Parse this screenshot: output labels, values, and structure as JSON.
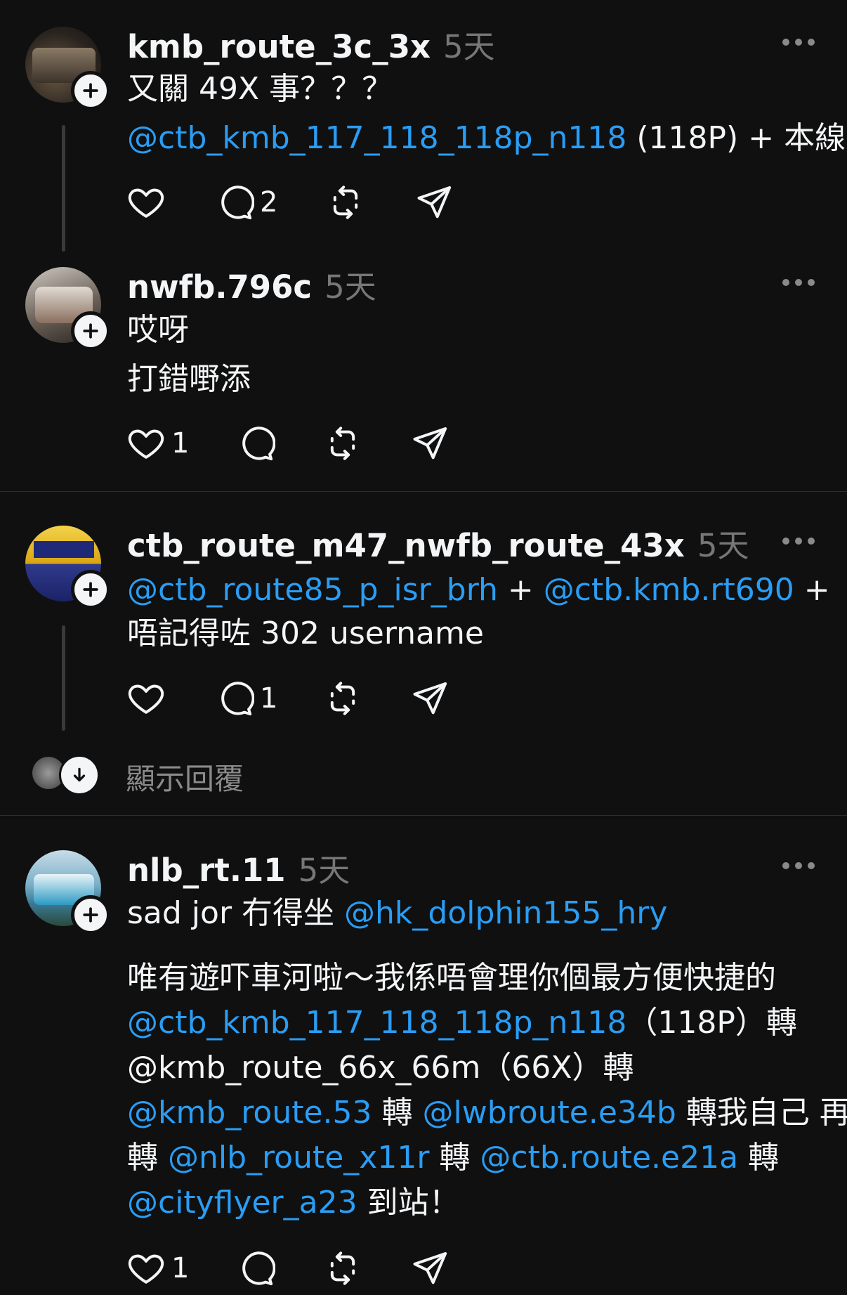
{
  "posts": [
    {
      "username": "kmb_route_3c_3x",
      "time": "5天",
      "line1": "又關 49X 事？？？",
      "line2_mention": "@ctb_kmb_117_118_118p_n118",
      "line2_rest": " (118P) + 本線",
      "likes": "",
      "replies": "2"
    },
    {
      "username": "nwfb.796c",
      "time": "5天",
      "line1": "哎呀",
      "line2": "打錯嘢添",
      "likes": "1",
      "replies": ""
    },
    {
      "username": "ctb_route_m47_nwfb_route_43x",
      "time": "5天",
      "l1_m1": "@ctb_route85_p_isr_brh",
      "l1_t1": " + ",
      "l1_m2": "@ctb.kmb.rt690",
      "l1_t2": " +",
      "line2": "唔記得咗 302 username",
      "likes": "",
      "replies": "1"
    },
    {
      "username": "nlb_rt.11",
      "time": "5天",
      "l1_t1": "sad jor 冇得坐 ",
      "l1_m1": "@hk_dolphin155_hry",
      "l2": "唯有遊吓車河啦～我係唔會理你個最方便快捷的",
      "l3_m1": "@ctb_kmb_117_118_118p_n118",
      "l3_t1": "（118P）轉",
      "l4": "@kmb_route_66x_66m（66X）轉",
      "l5_m1": "@kmb_route.53",
      "l5_t1": " 轉 ",
      "l5_m2": "@lwbroute.e34b",
      "l5_t2": " 轉我自己 再",
      "l6_t1": "轉 ",
      "l6_m1": "@nlb_route_x11r",
      "l6_t2": "  轉 ",
      "l6_m2": "@ctb.route.e21a",
      "l6_t3": "  轉",
      "l7_m1": "@cityflyer_a23",
      "l7_t1": "  到站！",
      "likes": "1",
      "replies": ""
    }
  ],
  "show_replies": "顯示回覆",
  "icons": [
    "heart-icon",
    "comment-icon",
    "repost-icon",
    "share-icon",
    "more-icon",
    "follow-plus-icon",
    "arrow-down-icon"
  ],
  "colors": {
    "background": "#101010",
    "mention": "#2a9df4",
    "muted": "#777777"
  }
}
